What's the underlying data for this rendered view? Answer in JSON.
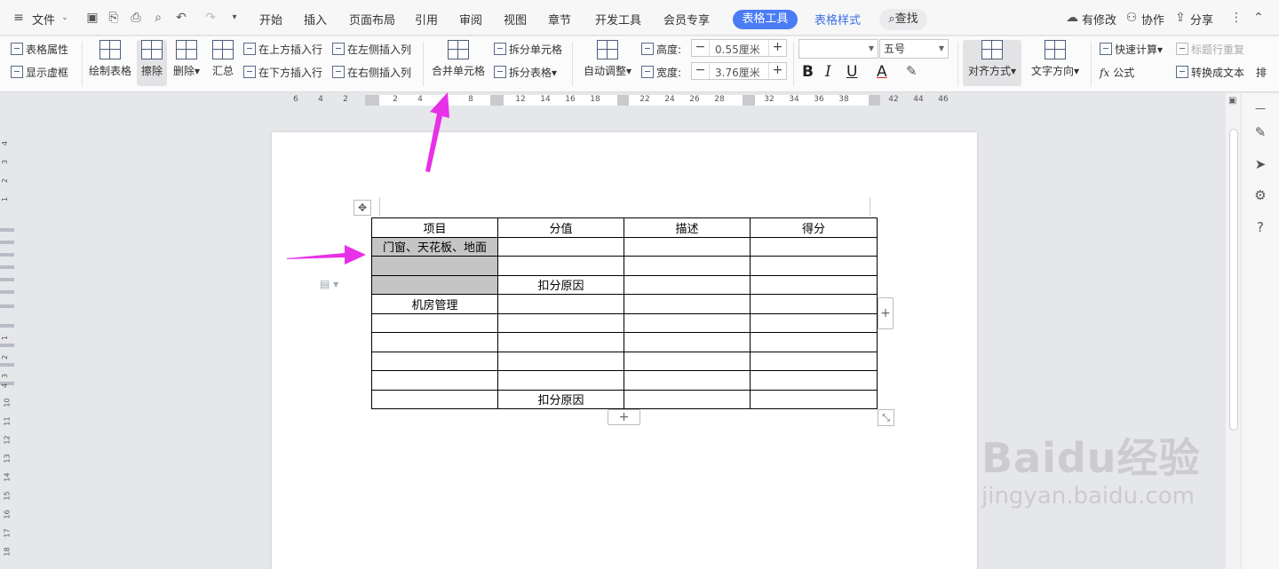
{
  "menubar": {
    "file": "文件",
    "tabs": [
      "开始",
      "插入",
      "页面布局",
      "引用",
      "审阅",
      "视图",
      "章节",
      "开发工具",
      "会员专享"
    ],
    "active_tab": "表格工具",
    "style_tab": "表格样式",
    "search": "查找",
    "has_changes": "有修改",
    "collaborate": "协作",
    "share": "分享"
  },
  "ribbon": {
    "table_props": "表格属性",
    "show_grid": "显示虚框",
    "draw_table": "绘制表格",
    "erase": "擦除",
    "delete": "删除",
    "summary": "汇总",
    "insert_above": "在上方插入行",
    "insert_below": "在下方插入行",
    "insert_left": "在左侧插入列",
    "insert_right": "在右侧插入列",
    "merge_cells": "合并单元格",
    "split_cells": "拆分单元格",
    "split_table": "拆分表格",
    "auto_fit": "自动调整",
    "height_label": "高度:",
    "height_value": "0.55厘米",
    "width_label": "宽度:",
    "width_value": "3.76厘米",
    "font_size": "五号",
    "align": "对齐方式",
    "text_dir": "文字方向",
    "quick_calc": "快速计算",
    "formula": "公式",
    "header_repeat": "标题行重复",
    "to_text": "转换成文本",
    "sort": "排"
  },
  "ruler_ticks": [
    "6",
    "4",
    "2",
    "2",
    "4",
    "8",
    "12",
    "14",
    "16",
    "18",
    "22",
    "24",
    "26",
    "28",
    "32",
    "34",
    "36",
    "38",
    "42",
    "44",
    "46"
  ],
  "vruler_ticks": [
    "4",
    "3",
    "2",
    "1",
    "1",
    "2",
    "3",
    "4",
    "10",
    "11",
    "12",
    "13",
    "14",
    "15",
    "16",
    "17",
    "18"
  ],
  "table": {
    "headers": [
      "项目",
      "分值",
      "描述",
      "得分"
    ],
    "rows": [
      [
        "门窗、天花板、地面",
        "",
        "",
        ""
      ],
      [
        "",
        "",
        "",
        ""
      ],
      [
        "",
        "扣分原因",
        "",
        ""
      ],
      [
        "机房管理",
        "",
        "",
        ""
      ],
      [
        "",
        "",
        "",
        ""
      ],
      [
        "",
        "",
        "",
        ""
      ],
      [
        "",
        "",
        "",
        ""
      ],
      [
        "",
        "",
        "",
        ""
      ],
      [
        "",
        "扣分原因",
        "",
        ""
      ]
    ]
  },
  "watermark": {
    "logo": "Baidu经验",
    "url": "jingyan.baidu.com"
  },
  "colors": {
    "accent": "#4a7cf5",
    "arrow": "#e830e8",
    "selected_cell": "#c5c5c5"
  }
}
